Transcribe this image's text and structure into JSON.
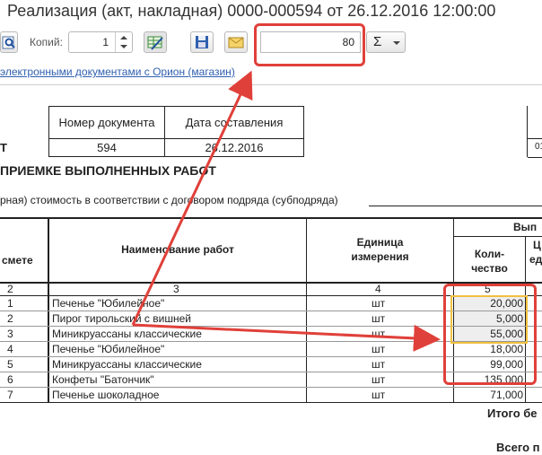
{
  "window": {
    "title": "Реализация (акт, накладная) 0000-000594 от 26.12.2016 12:00:00"
  },
  "toolbar": {
    "copies_label": "Копий:",
    "copies_value": "1",
    "scale_value": "80",
    "sum_symbol": "Σ"
  },
  "link_text": "электронными документами с Орион (магазин)",
  "doc_header": {
    "number_label": "Номер документа",
    "date_label": "Дата составления",
    "number": "594",
    "date": "26.12.2016",
    "left_fragment": "Т",
    "right_fragment": "01"
  },
  "heading": "ПРИЕМКЕ ВЫПОЛНЕННЫХ РАБОТ",
  "subtext": "рная) стоимость в соответствии с договором подряда (субподряда)",
  "table": {
    "col_headers": {
      "smete": "смете",
      "name": "Наименование работ",
      "unit_line1": "Единица",
      "unit_line2": "измерения",
      "qty_line1": "Коли-",
      "qty_line2": "чество",
      "group": "Вып",
      "price_a": "Ц",
      "price_b": "ед"
    },
    "col_numbers": [
      "2",
      "3",
      "4",
      "5"
    ],
    "rows": [
      {
        "idx": "1",
        "name": "Печенье \"Юбилейное\"",
        "unit": "шт",
        "qty": "20,000"
      },
      {
        "idx": "2",
        "name": "Пирог тирольский с вишней",
        "unit": "шт",
        "qty": "5,000"
      },
      {
        "idx": "3",
        "name": "Миникруассаны классические",
        "unit": "шт",
        "qty": "55,000"
      },
      {
        "idx": "4",
        "name": "Печенье \"Юбилейное\"",
        "unit": "шт",
        "qty": "18,000"
      },
      {
        "idx": "5",
        "name": "Миникруассаны классические",
        "unit": "шт",
        "qty": "99,000"
      },
      {
        "idx": "6",
        "name": "Конфеты \"Батончик\"",
        "unit": "шт",
        "qty": "135,000"
      },
      {
        "idx": "7",
        "name": "Печенье шоколадное",
        "unit": "шт",
        "qty": "71,000"
      }
    ],
    "total_label": "Итого бе",
    "grand_total_label": "Всего п"
  },
  "annotation_color": "#e0403a"
}
